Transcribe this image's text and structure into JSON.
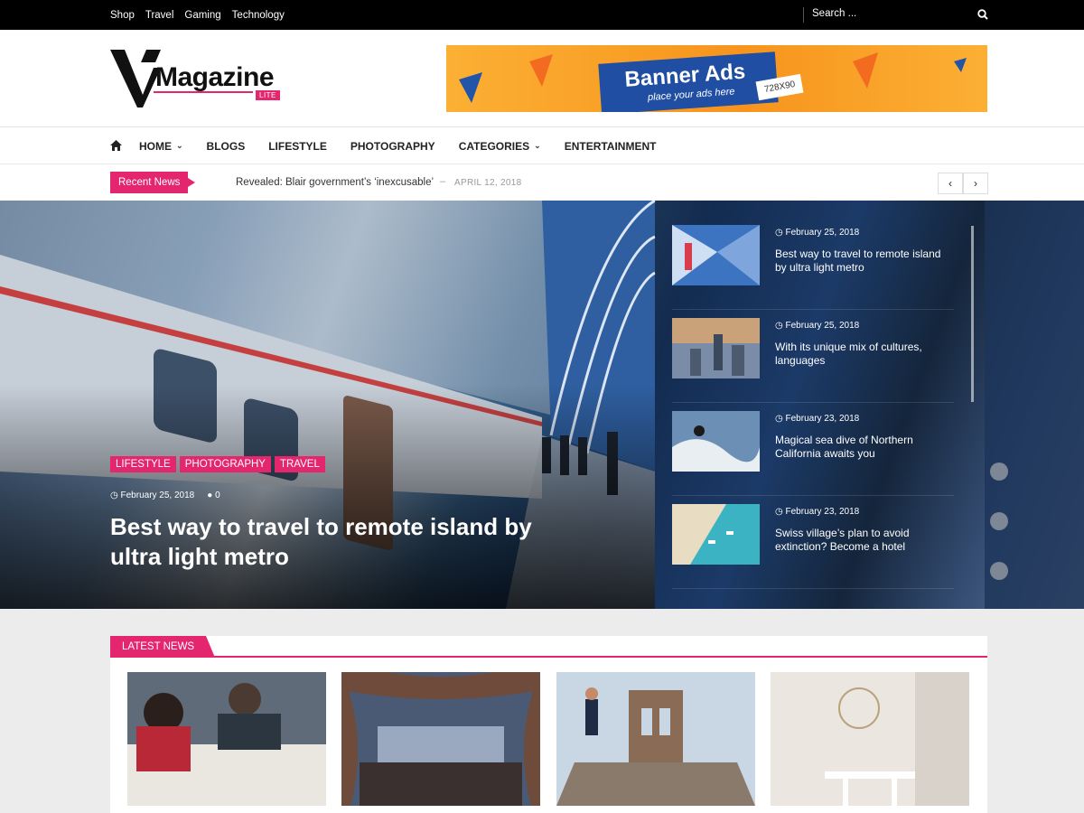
{
  "topbar": {
    "links": [
      "Shop",
      "Travel",
      "Gaming",
      "Technology"
    ],
    "search_placeholder": "Search ..."
  },
  "logo": {
    "wordmark": "Magazine",
    "badge": "LITE"
  },
  "banner": {
    "title": "Banner Ads",
    "subtitle": "place your ads here",
    "size": "728X90"
  },
  "nav": {
    "items": [
      {
        "label": "HOME",
        "dropdown": true
      },
      {
        "label": "BLOGS",
        "dropdown": false
      },
      {
        "label": "LIFESTYLE",
        "dropdown": false
      },
      {
        "label": "PHOTOGRAPHY",
        "dropdown": false
      },
      {
        "label": "CATEGORIES",
        "dropdown": true
      },
      {
        "label": "ENTERTAINMENT",
        "dropdown": false
      }
    ]
  },
  "ticker": {
    "label": "Recent News",
    "headline": "Revealed: Blair government’s ‘inexcusable’",
    "separator": "–",
    "date": "APRIL 12, 2018",
    "prev": "‹",
    "next": "›"
  },
  "hero": {
    "tags": [
      "LIFESTYLE",
      "PHOTOGRAPHY",
      "TRAVEL"
    ],
    "date": "February 25, 2018",
    "comments": "0",
    "title": "Best way to travel to remote island by ultra light metro"
  },
  "side_posts": [
    {
      "date": "February 25, 2018",
      "title": "Best way to travel to remote island by ultra light metro"
    },
    {
      "date": "February 25, 2018",
      "title": "With its unique mix of cultures, languages"
    },
    {
      "date": "February 23, 2018",
      "title": "Magical sea dive of Northern California awaits you"
    },
    {
      "date": "February 23, 2018",
      "title": "Swiss village’s plan to avoid extinction? Become a hotel"
    }
  ],
  "latest": {
    "label": "LATEST NEWS"
  },
  "colors": {
    "accent": "#e4266e",
    "topbar": "#000000",
    "banner_blue": "#1f4ea3",
    "banner_orange": "#f7941d"
  },
  "icons": [
    "search-icon",
    "home-icon",
    "clock-icon",
    "comment-icon",
    "chevron-down-icon",
    "chevron-left-icon",
    "chevron-right-icon"
  ]
}
